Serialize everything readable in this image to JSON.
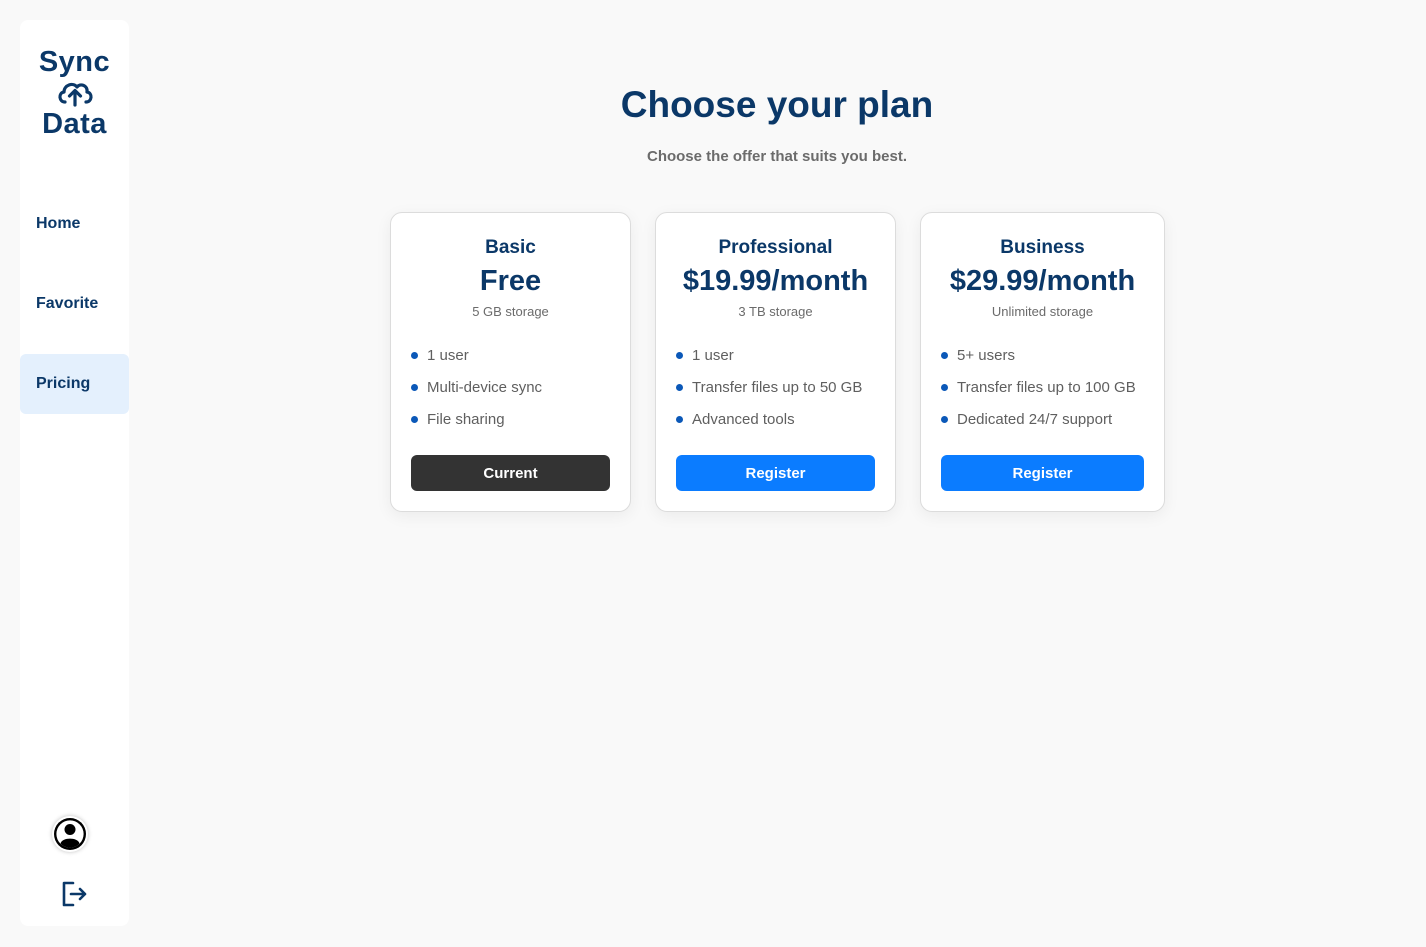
{
  "app": {
    "logo_top": "Sync",
    "logo_bottom": "Data"
  },
  "sidebar": {
    "items": [
      {
        "label": "Home"
      },
      {
        "label": "Favorite"
      },
      {
        "label": "Pricing",
        "active": true
      }
    ]
  },
  "main": {
    "title": "Choose your plan",
    "subtitle": "Choose the offer that suits you best."
  },
  "plans": [
    {
      "name": "Basic",
      "price": "Free",
      "storage": "5 GB storage",
      "features": [
        "1 user",
        "Multi-device sync",
        "File sharing"
      ],
      "button": "Current"
    },
    {
      "name": "Professional",
      "price": "$19.99/month",
      "storage": "3 TB storage",
      "features": [
        "1 user",
        "Transfer files up to 50 GB",
        "Advanced tools"
      ],
      "button": "Register"
    },
    {
      "name": "Business",
      "price": "$29.99/month",
      "storage": "Unlimited storage",
      "features": [
        "5+ users",
        "Transfer files up to 100 GB",
        "Dedicated 24/7 support"
      ],
      "button": "Register"
    }
  ],
  "colors": {
    "brand": "#0b3868",
    "accent": "#0b7cff",
    "current_button": "#333333",
    "active_nav_bg": "#e4f0fd"
  },
  "icons": {
    "logo": "cloud-upload-icon",
    "avatar": "user-circle-icon",
    "logout": "logout-icon"
  }
}
